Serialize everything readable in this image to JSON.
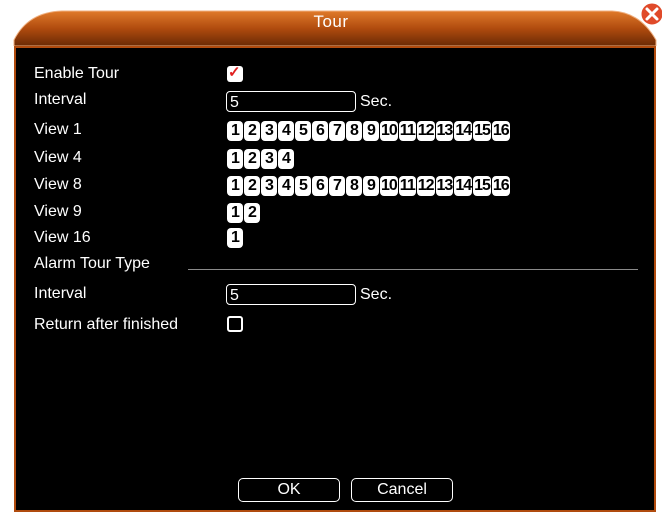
{
  "window": {
    "title": "Tour",
    "accent_color": "#b04b0e",
    "close_icon": "close-icon"
  },
  "form": {
    "enable_tour_label": "Enable Tour",
    "enable_tour_checked": true,
    "interval_label": "Interval",
    "interval_value": "5",
    "interval_unit": "Sec.",
    "views": [
      {
        "label": "View 1",
        "channels": [
          "1",
          "2",
          "3",
          "4",
          "5",
          "6",
          "7",
          "8",
          "9",
          "10",
          "11",
          "12",
          "13",
          "14",
          "15",
          "16"
        ]
      },
      {
        "label": "View 4",
        "channels": [
          "1",
          "2",
          "3",
          "4"
        ]
      },
      {
        "label": "View 8",
        "channels": [
          "1",
          "2",
          "3",
          "4",
          "5",
          "6",
          "7",
          "8",
          "9",
          "10",
          "11",
          "12",
          "13",
          "14",
          "15",
          "16"
        ]
      },
      {
        "label": "View 9",
        "channels": [
          "1",
          "2"
        ]
      },
      {
        "label": "View 16",
        "channels": [
          "1"
        ]
      }
    ],
    "alarm_section_label": "Alarm Tour Type",
    "alarm_interval_label": "Interval",
    "alarm_interval_value": "5",
    "alarm_interval_unit": "Sec.",
    "return_label": "Return after finished",
    "return_checked": false
  },
  "buttons": {
    "ok": "OK",
    "cancel": "Cancel"
  }
}
